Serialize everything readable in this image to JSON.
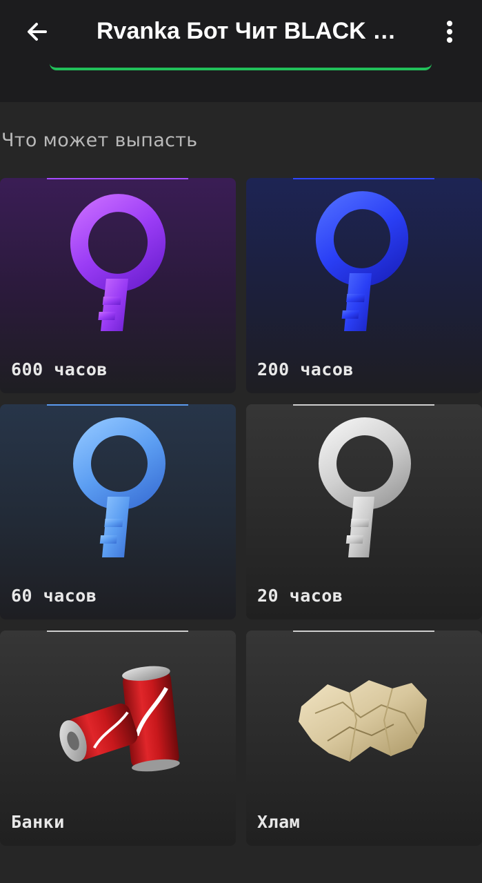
{
  "app_bar": {
    "title": "Rvanka Бот Чит BLACK RUSSIA",
    "back_icon": "arrow-left-icon",
    "menu_icon": "more-vert-icon"
  },
  "section": {
    "title": "Что может выпасть"
  },
  "colors": {
    "background": "#262626",
    "app_bar": "#1c1c1e",
    "accent_green": "#22c05a",
    "purple": "#a64bff",
    "blue": "#2e45ff",
    "light_blue": "#5b9bf0",
    "silver": "#cfcfcf"
  },
  "items": [
    {
      "label": "600 часов",
      "icon": "purple-key-icon",
      "accent": "#a64bff"
    },
    {
      "label": "200 часов",
      "icon": "blue-key-icon",
      "accent": "#2e45ff"
    },
    {
      "label": "60 часов",
      "icon": "light-blue-key-icon",
      "accent": "#5b9bf0"
    },
    {
      "label": "20 часов",
      "icon": "silver-key-icon",
      "accent": "#cfcfcf"
    },
    {
      "label": "Банки",
      "icon": "cola-cans-icon",
      "accent": "#cfcfcf"
    },
    {
      "label": "Хлам",
      "icon": "crumpled-paper-icon",
      "accent": "#cfcfcf"
    }
  ]
}
